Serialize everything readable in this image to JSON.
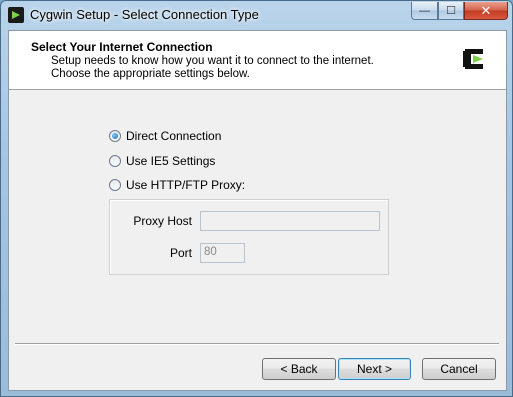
{
  "window": {
    "title": "Cygwin Setup - Select Connection Type",
    "controls": {
      "minimize": "—",
      "maximize": "☐",
      "close": "✕"
    }
  },
  "header": {
    "title": "Select Your Internet Connection",
    "description": "Setup needs to know how you want it to connect to the internet.  Choose the appropriate settings below.",
    "logo_icon": "cygwin-logo-icon"
  },
  "connection": {
    "options": [
      {
        "label": "Direct Connection",
        "selected": true
      },
      {
        "label": "Use IE5 Settings",
        "selected": false
      },
      {
        "label": "Use HTTP/FTP Proxy:",
        "selected": false
      }
    ],
    "proxy": {
      "host_label": "Proxy Host",
      "host_value": "",
      "port_label": "Port",
      "port_value": "80"
    }
  },
  "buttons": {
    "back": "< Back",
    "next": "Next >",
    "cancel": "Cancel"
  },
  "colors": {
    "accent": "#3c7fb1",
    "logo_green": "#7cd04a",
    "close_red": "#c23a22"
  }
}
